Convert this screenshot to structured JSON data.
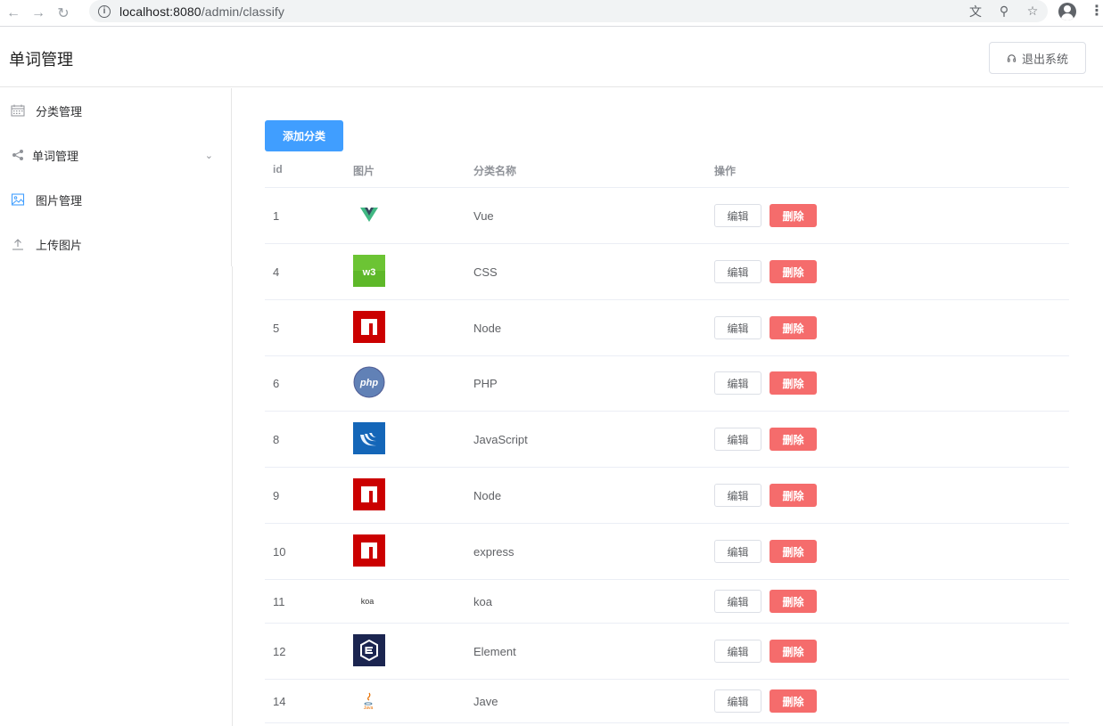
{
  "browser": {
    "url_host": "localhost:8080",
    "url_path": "/admin/classify"
  },
  "header": {
    "title": "单词管理",
    "logout_label": "退出系统"
  },
  "sidebar": {
    "items": [
      {
        "label": "分类管理",
        "icon": "calendar-icon"
      },
      {
        "label": "单词管理",
        "icon": "share-icon"
      },
      {
        "label": "图片管理",
        "icon": "picture-icon"
      },
      {
        "label": "上传图片",
        "icon": "upload-icon"
      }
    ]
  },
  "main": {
    "add_button": "添加分类",
    "table": {
      "columns": [
        "id",
        "图片",
        "分类名称",
        "操作"
      ],
      "edit_label": "编辑",
      "delete_label": "删除",
      "rows": [
        {
          "id": "1",
          "name": "Vue",
          "logo": "vue-logo"
        },
        {
          "id": "4",
          "name": "CSS",
          "logo": "css3-logo"
        },
        {
          "id": "5",
          "name": "Node",
          "logo": "npm-logo"
        },
        {
          "id": "6",
          "name": "PHP",
          "logo": "php-logo"
        },
        {
          "id": "8",
          "name": "JavaScript",
          "logo": "jquery-logo"
        },
        {
          "id": "9",
          "name": "Node",
          "logo": "npm-logo"
        },
        {
          "id": "10",
          "name": "express",
          "logo": "npm-logo"
        },
        {
          "id": "11",
          "name": "koa",
          "logo": "koa-logo"
        },
        {
          "id": "12",
          "name": "Element",
          "logo": "element-logo"
        },
        {
          "id": "14",
          "name": "Jave",
          "logo": "java-logo"
        }
      ]
    }
  },
  "colors": {
    "primary": "#409eff",
    "danger": "#f56c6c"
  }
}
